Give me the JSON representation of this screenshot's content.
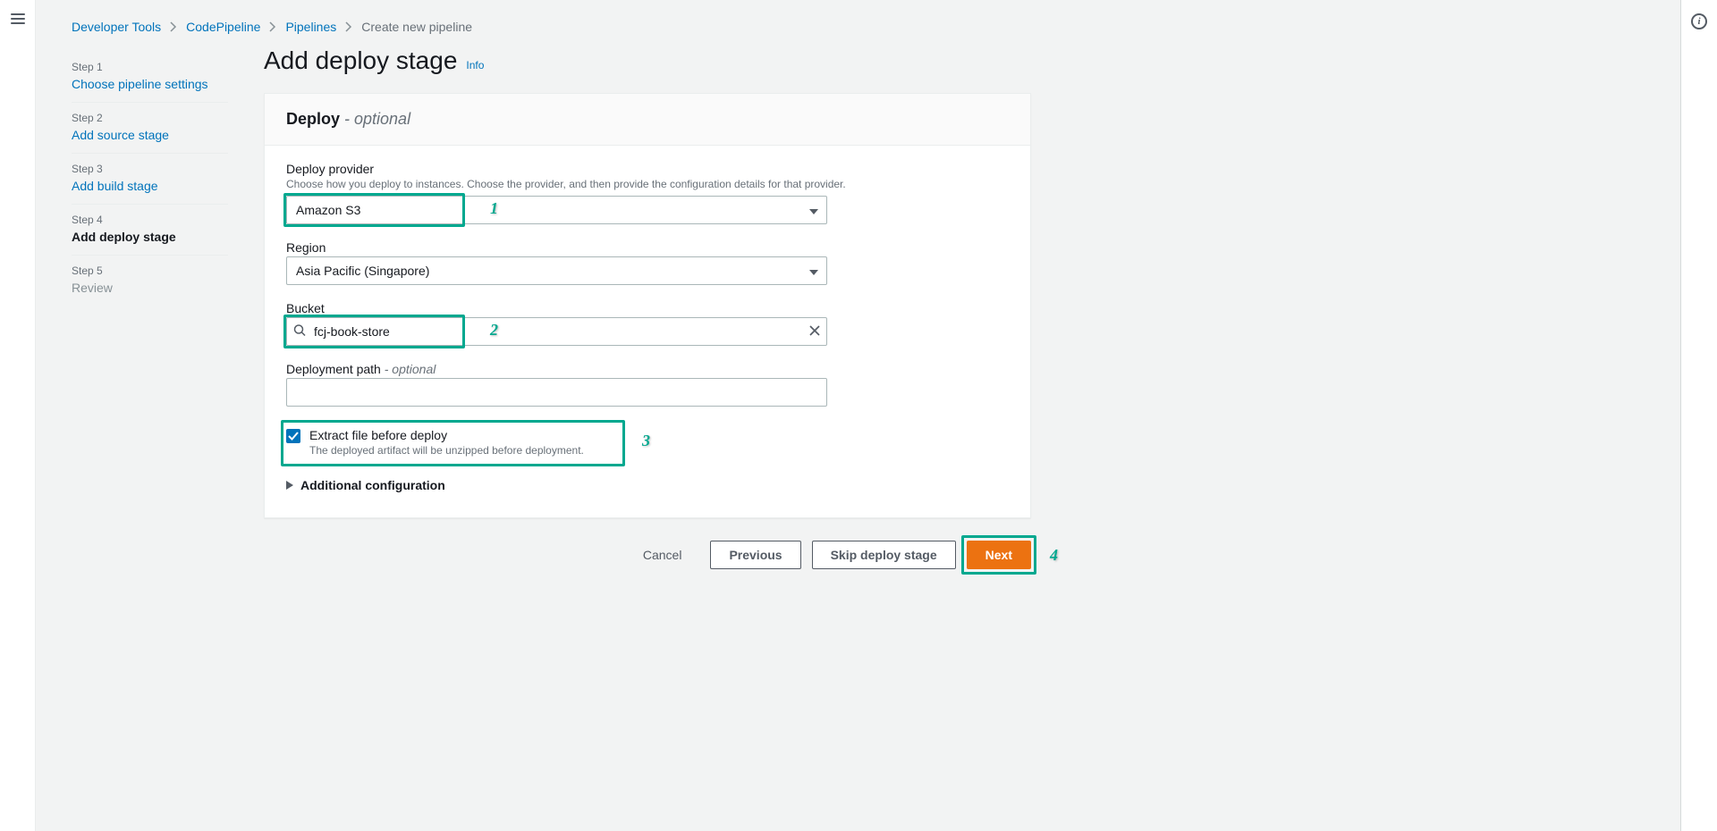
{
  "breadcrumbs": {
    "items": [
      "Developer Tools",
      "CodePipeline",
      "Pipelines",
      "Create new pipeline"
    ]
  },
  "steps": {
    "items": [
      {
        "label": "Step 1",
        "name": "Choose pipeline settings",
        "state": "link"
      },
      {
        "label": "Step 2",
        "name": "Add source stage",
        "state": "link"
      },
      {
        "label": "Step 3",
        "name": "Add build stage",
        "state": "link"
      },
      {
        "label": "Step 4",
        "name": "Add deploy stage",
        "state": "active"
      },
      {
        "label": "Step 5",
        "name": "Review",
        "state": "disabled"
      }
    ]
  },
  "page": {
    "title": "Add deploy stage",
    "info_label": "Info"
  },
  "card": {
    "title": "Deploy",
    "title_sep": " - ",
    "optional": "optional"
  },
  "fields": {
    "provider": {
      "label": "Deploy provider",
      "desc": "Choose how you deploy to instances. Choose the provider, and then provide the configuration details for that provider.",
      "value": "Amazon S3"
    },
    "region": {
      "label": "Region",
      "value": "Asia Pacific (Singapore)"
    },
    "bucket": {
      "label": "Bucket",
      "value": "fcj-book-store"
    },
    "deployment_path": {
      "label": "Deployment path",
      "label_sep": " - ",
      "optional": "optional",
      "value": ""
    },
    "extract": {
      "label": "Extract file before deploy",
      "desc": "The deployed artifact will be unzipped before deployment.",
      "checked": true
    },
    "additional": {
      "label": "Additional configuration"
    }
  },
  "buttons": {
    "cancel": "Cancel",
    "previous": "Previous",
    "skip": "Skip deploy stage",
    "next": "Next"
  },
  "annotations": {
    "one": "1",
    "two": "2",
    "three": "3",
    "four": "4"
  }
}
